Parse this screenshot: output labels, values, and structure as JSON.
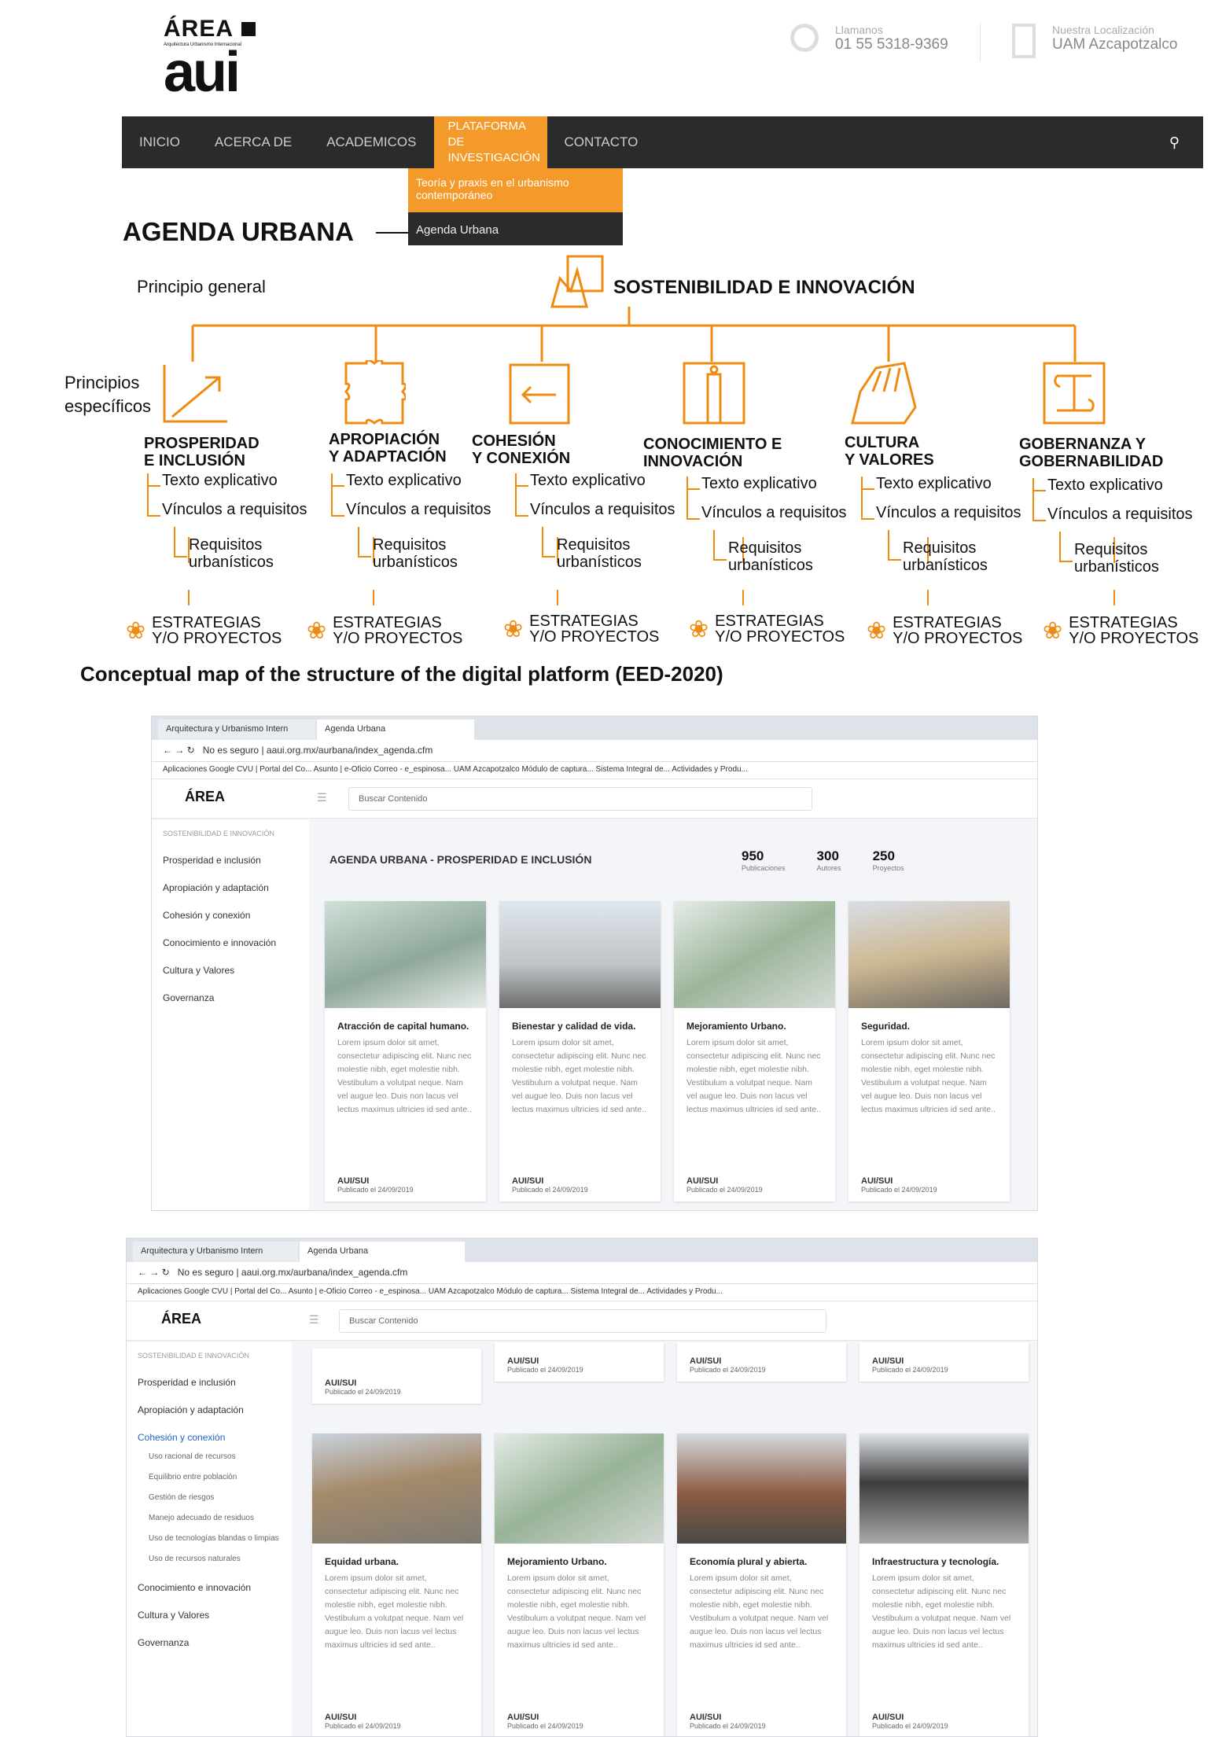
{
  "header": {
    "logo_title": "ÁREA",
    "logo_subtitle": "Arquitectura Urbanismo Internacional",
    "logo_mark": "aui",
    "phone_label": "Llamanos",
    "phone_value": "01 55 5318-9369",
    "location_label": "Nuestra Localización",
    "location_value": "UAM Azcapotzalco"
  },
  "nav": {
    "items": [
      "INICIO",
      "ACERCA DE",
      "ACADEMICOS",
      "PLATAFORMA DE INVESTIGACIÓN",
      "CONTACTO"
    ],
    "dropdown": [
      "Teoría y praxis en el urbanismo contemporáneo",
      "Agenda Urbana"
    ]
  },
  "diagram": {
    "title": "AGENDA URBANA",
    "principio_general": "Principio general",
    "main": "SOSTENIBILIDAD E INNOVACIÓN",
    "principios_especificos": "Principios específicos",
    "branches": [
      {
        "title": [
          "PROSPERIDAD",
          "E INCLUSIÓN"
        ]
      },
      {
        "title": [
          "APROPIACIÓN",
          "Y ADAPTACIÓN"
        ]
      },
      {
        "title": [
          "COHESIÓN",
          "Y CONEXIÓN"
        ]
      },
      {
        "title": [
          "CONOCIMIENTO E",
          "INNOVACIÓN"
        ]
      },
      {
        "title": [
          "CULTURA",
          "Y VALORES"
        ]
      },
      {
        "title": [
          "GOBERNANZA Y",
          "GOBERNABILIDAD"
        ]
      }
    ],
    "texto": "Texto explicativo",
    "vinculos": "Vínculos a requisitos",
    "requisitos": [
      "Requisitos",
      "urbanísticos"
    ],
    "estrategias": [
      "ESTRATEGIAS",
      "Y/O PROYECTOS"
    ]
  },
  "caption": "Conceptual map of the structure of the digital platform (EED-2020)",
  "browser": {
    "tab1": "Arquitectura y Urbanismo Intern",
    "tab2": "Agenda Urbana",
    "url": "No es seguro | aaui.org.mx/aurbana/index_agenda.cfm",
    "bookmarks": "Aplicaciones   Google   CVU | Portal del Co...   Asunto | e-Oficio   Correo - e_espinosa...   UAM Azcapotzalco   Módulo de captura...   Sistema Integral de...   Actividades y Produ...",
    "search": "Buscar Contenido"
  },
  "shot1": {
    "side_header": "SOSTENIBILIDAD E INNOVACIÓN",
    "side_items": [
      "Prosperidad e inclusión",
      "Apropiación y adaptación",
      "Cohesión y conexión",
      "Conocimiento e innovación",
      "Cultura y Valores",
      "Governanza"
    ],
    "page_title": "AGENDA URBANA - PROSPERIDAD E INCLUSIÓN",
    "stats": [
      {
        "value": "950",
        "label": "Publicaciones"
      },
      {
        "value": "300",
        "label": "Autores"
      },
      {
        "value": "250",
        "label": "Proyectos"
      }
    ],
    "cards": [
      {
        "title": "Atracción de capital humano."
      },
      {
        "title": "Bienestar y calidad de vida."
      },
      {
        "title": "Mejoramiento Urbano."
      },
      {
        "title": "Seguridad."
      }
    ]
  },
  "shot2": {
    "side_items": [
      "Prosperidad e inclusión",
      "Apropiación y adaptación",
      "Cohesión y conexión"
    ],
    "sub_items": [
      "Uso racional de recursos",
      "Equilibrio entre población",
      "Gestión de riesgos",
      "Manejo adecuado de residuos",
      "Uso de tecnologías blandas o limpias",
      "Uso de recursos naturales"
    ],
    "side_items2": [
      "Conocimiento e innovación",
      "Cultura y Valores",
      "Governanza"
    ],
    "cards": [
      {
        "title": "Equidad urbana."
      },
      {
        "title": "Mejoramiento Urbano."
      },
      {
        "title": "Economía plural y abierta."
      },
      {
        "title": "Infraestructura y tecnología."
      }
    ]
  },
  "card_common": {
    "body": "Lorem ipsum dolor sit amet, consectetur adipiscing elit. Nunc nec molestie nibh, eget molestie nibh. Vestibulum a volutpat neque. Nam vel augue leo. Duis non lacus vel lectus maximus ultricies id sed ante..",
    "author": "AUI/SUI",
    "published": "Publicado el 24/09/2019"
  },
  "colors": {
    "orange": "#f08b12",
    "nav": "#2b2b2b",
    "blue": "#1e64c8"
  }
}
